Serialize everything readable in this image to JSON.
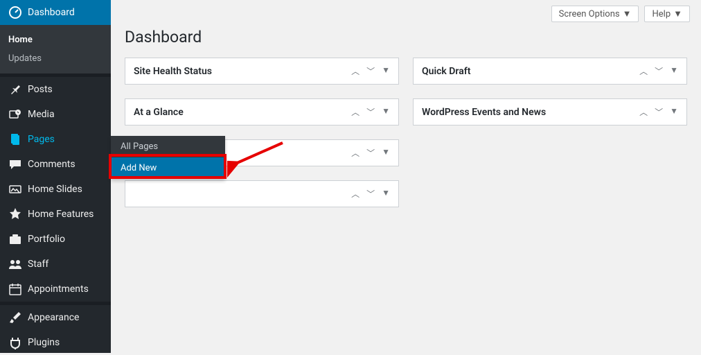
{
  "header": {
    "screen_options": "Screen Options",
    "help": "Help"
  },
  "page_title": "Dashboard",
  "sidebar": {
    "dashboard": "Dashboard",
    "home": "Home",
    "updates": "Updates",
    "posts": "Posts",
    "media": "Media",
    "pages": "Pages",
    "comments": "Comments",
    "home_slides": "Home Slides",
    "home_features": "Home Features",
    "portfolio": "Portfolio",
    "staff": "Staff",
    "appointments": "Appointments",
    "appearance": "Appearance",
    "plugins": "Plugins"
  },
  "pages_flyout": {
    "all_pages": "All Pages",
    "add_new": "Add New"
  },
  "panels": {
    "left": [
      {
        "title": "Site Health Status"
      },
      {
        "title": "At a Glance"
      },
      {
        "title": ""
      },
      {
        "title": ""
      }
    ],
    "right": [
      {
        "title": "Quick Draft"
      },
      {
        "title": "WordPress Events and News"
      }
    ]
  }
}
